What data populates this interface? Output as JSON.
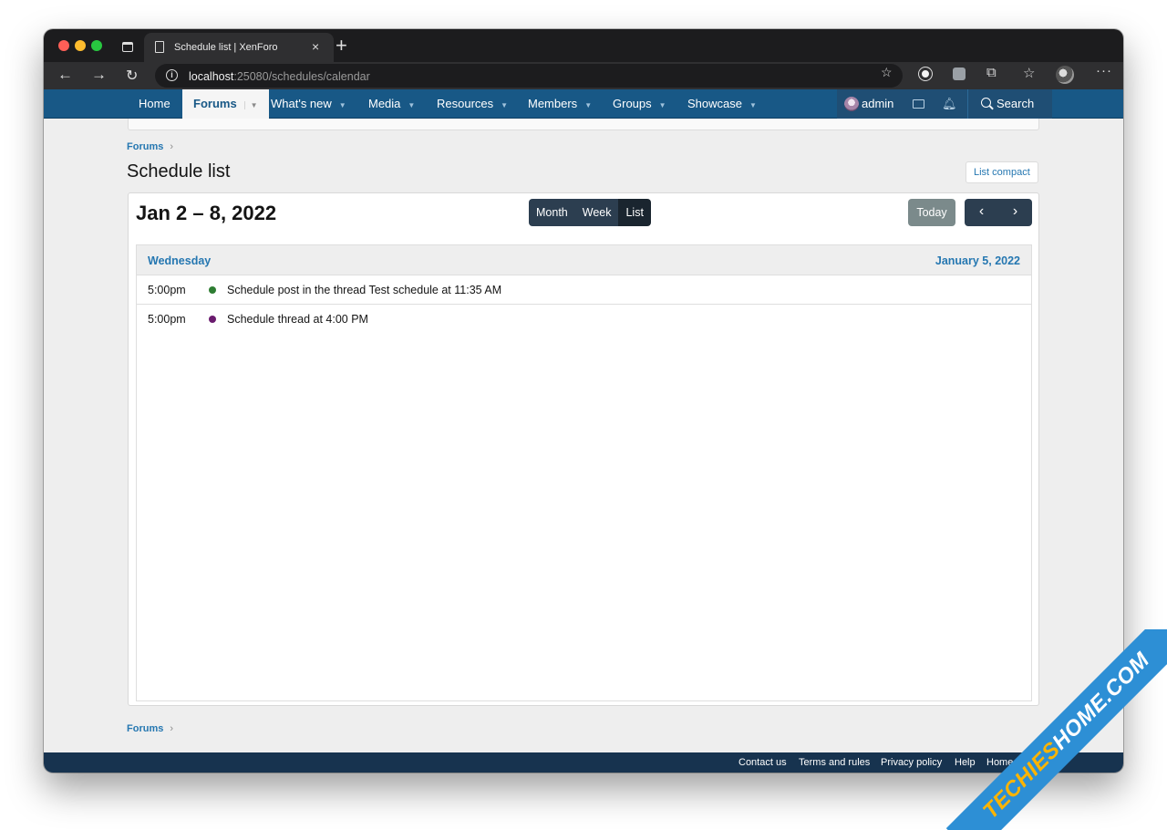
{
  "browser": {
    "tab_title": "Schedule list | XenForo",
    "new_tab_symbol": "+",
    "close_symbol": "×",
    "url_host": "localhost",
    "url_rest": ":25080/schedules/calendar"
  },
  "nav": {
    "home": "Home",
    "forums": "Forums",
    "whats_new": "What's new",
    "media": "Media",
    "resources": "Resources",
    "members": "Members",
    "groups": "Groups",
    "showcase": "Showcase",
    "caret": "▼",
    "username": "admin",
    "search": "Search"
  },
  "breadcrumb": {
    "forums": "Forums",
    "separator": "›"
  },
  "page": {
    "title": "Schedule list",
    "list_compact": "List compact"
  },
  "calendar": {
    "range_title": "Jan 2 – 8, 2022",
    "views": {
      "month": "Month",
      "week": "Week",
      "list": "List"
    },
    "active_view": "List",
    "today": "Today",
    "prev": "‹",
    "next": "›",
    "day": {
      "name": "Wednesday",
      "date": "January 5, 2022"
    },
    "events": [
      {
        "time": "5:00pm",
        "title": "Schedule post in the thread Test schedule at 11:35 AM",
        "color": "#2e7d32"
      },
      {
        "time": "5:00pm",
        "title": "Schedule thread at 4:00 PM",
        "color": "#6a1b6e"
      }
    ]
  },
  "footer": {
    "contact": "Contact us",
    "terms": "Terms and rules",
    "privacy": "Privacy policy",
    "help": "Help",
    "home": "Home"
  },
  "watermark": {
    "part1": "TECHIES",
    "part2": "HOME.COM"
  },
  "colors": {
    "nav_bg": "#185886",
    "link": "#2577b1",
    "button_dark": "#2c3e50"
  }
}
